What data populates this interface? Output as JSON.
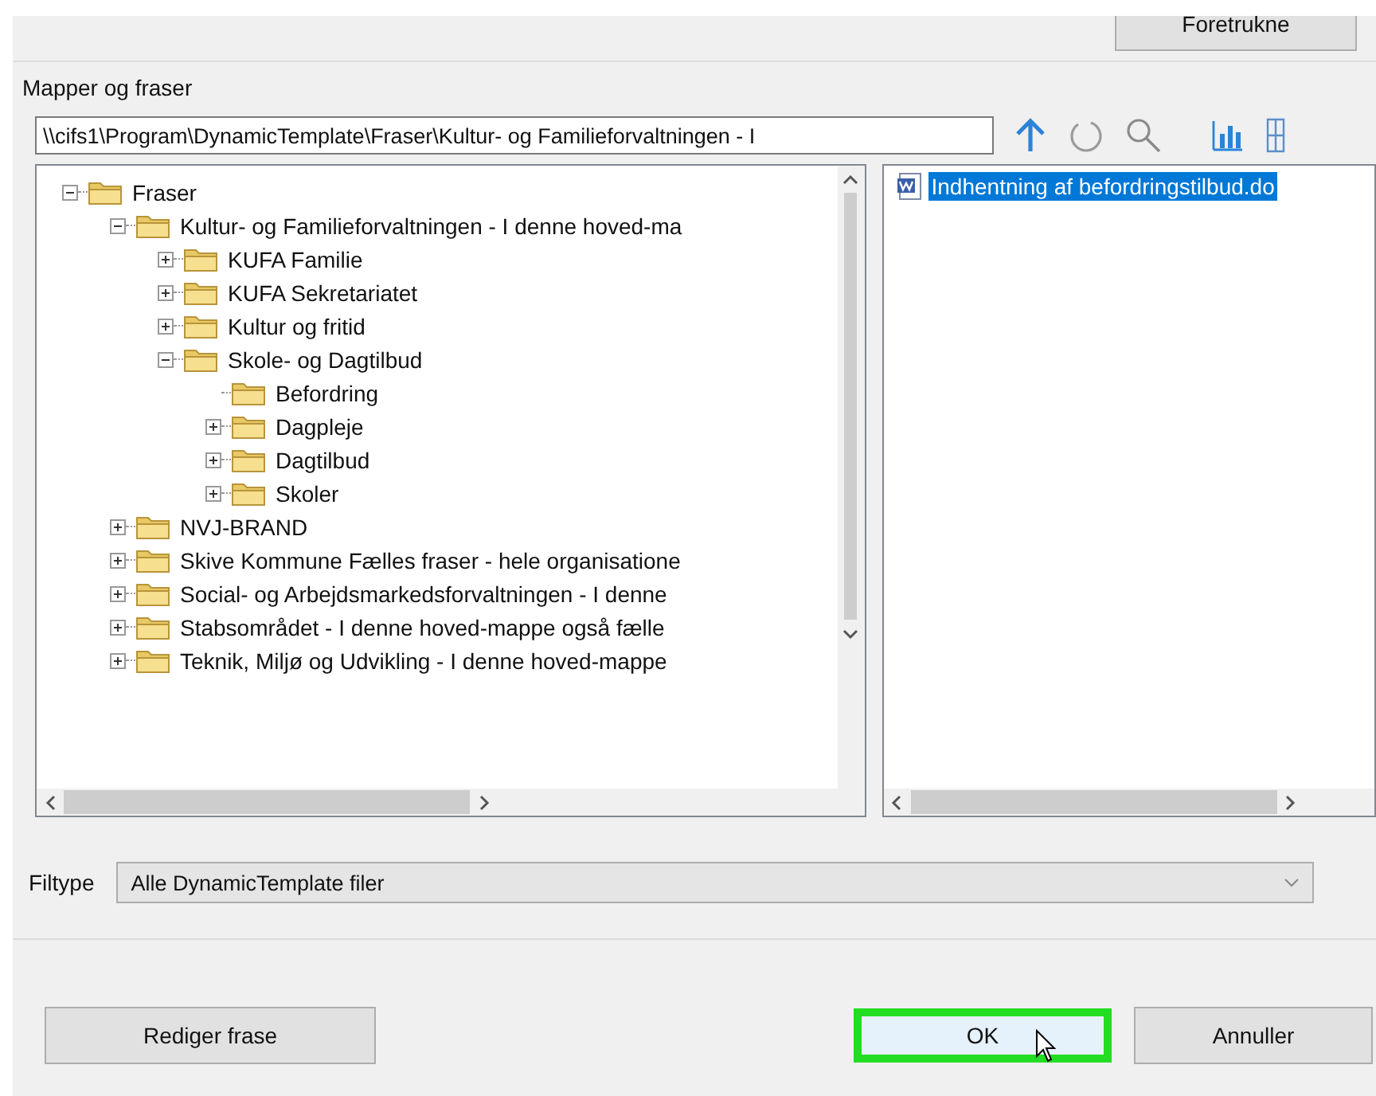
{
  "top_button": {
    "label": "Foretrukne"
  },
  "section_label": "Mapper og fraser",
  "path_field": {
    "value": "\\\\cifs1\\Program\\DynamicTemplate\\Fraser\\Kultur- og Familieforvaltningen - I"
  },
  "tree": [
    {
      "label": "Fraser",
      "expanded": true,
      "children": [
        {
          "label": "Kultur- og Familieforvaltningen - I denne hoved-ma",
          "expanded": true,
          "children": [
            {
              "label": "KUFA Familie",
              "expanded": false
            },
            {
              "label": "KUFA Sekretariatet",
              "expanded": false
            },
            {
              "label": "Kultur og fritid",
              "expanded": false
            },
            {
              "label": "Skole- og Dagtilbud",
              "expanded": true,
              "children": [
                {
                  "label": "Befordring"
                },
                {
                  "label": "Dagpleje",
                  "expanded": false
                },
                {
                  "label": "Dagtilbud",
                  "expanded": false
                },
                {
                  "label": "Skoler",
                  "expanded": false
                }
              ]
            }
          ]
        },
        {
          "label": "NVJ-BRAND",
          "expanded": false
        },
        {
          "label": "Skive Kommune Fælles fraser - hele organisatione",
          "expanded": false
        },
        {
          "label": "Social- og Arbejdsmarkedsforvaltningen - I denne",
          "expanded": false
        },
        {
          "label": "Stabsområdet - I denne hoved-mappe  også fælle",
          "expanded": false
        },
        {
          "label": "Teknik, Miljø og Udvikling - I denne hoved-mappe",
          "expanded": false
        }
      ]
    }
  ],
  "files": [
    {
      "label": "Indhentning af befordringstilbud.do",
      "selected": true
    }
  ],
  "filetype": {
    "label": "Filtype",
    "value": "Alle DynamicTemplate filer"
  },
  "buttons": [
    {
      "label": "Rediger frase",
      "focused": false
    },
    {
      "label": "OK",
      "focused": true
    },
    {
      "label": "Annuller",
      "focused": false
    }
  ]
}
